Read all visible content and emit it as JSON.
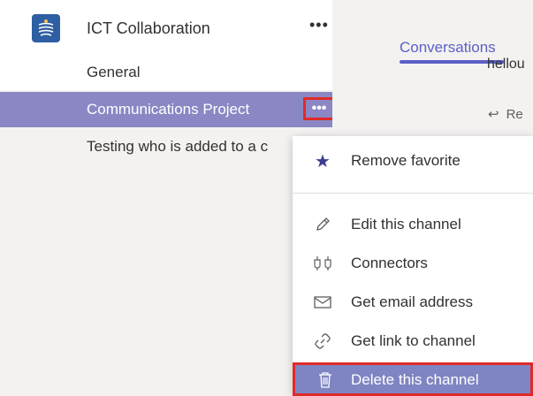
{
  "team": {
    "name": "ICT Collaboration",
    "more": "•••",
    "logo_color": "#2f5fa3"
  },
  "channels": [
    {
      "label": "General"
    },
    {
      "label": "Communications Project",
      "more": "•••"
    },
    {
      "label": "Testing who is added to a c"
    }
  ],
  "conversation": {
    "tab_label": "Conversations",
    "message_fragment": "hellou",
    "reply_label": "Re"
  },
  "menu": {
    "items": [
      {
        "label": "Remove favorite",
        "icon": "star-icon"
      },
      {
        "label": "Edit this channel",
        "icon": "pencil-icon"
      },
      {
        "label": "Connectors",
        "icon": "connectors-icon"
      },
      {
        "label": "Get email address",
        "icon": "envelope-icon"
      },
      {
        "label": "Get link to channel",
        "icon": "link-icon"
      },
      {
        "label": "Delete this channel",
        "icon": "trash-icon"
      }
    ]
  },
  "colors": {
    "accent": "#5b5fc7",
    "selected_bg": "#8a87c4",
    "highlight_border": "#e02a2a"
  }
}
